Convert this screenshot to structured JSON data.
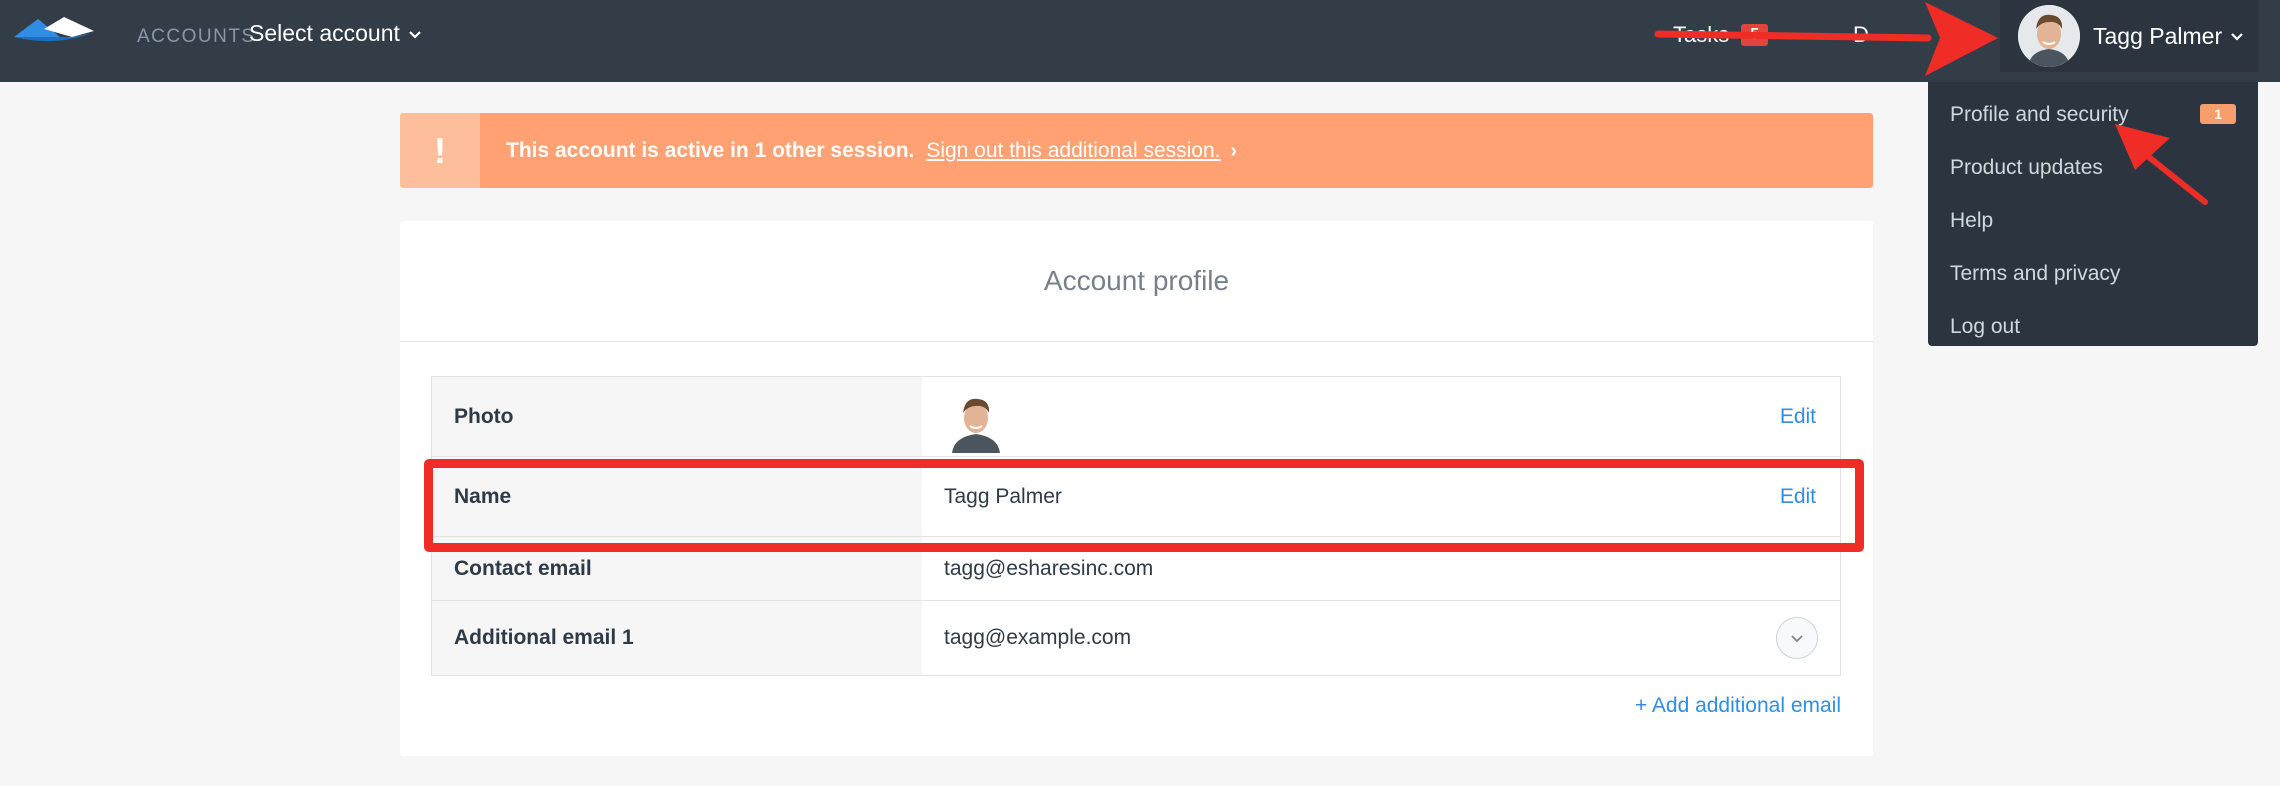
{
  "nav": {
    "accounts_label": "ACCOUNTS",
    "select_account": "Select account",
    "tasks_label": "Tasks",
    "tasks_count": "5",
    "extra_label": "D",
    "user_name": "Tagg Palmer"
  },
  "dropdown": {
    "items": [
      {
        "label": "Profile and security",
        "badge": "1"
      },
      {
        "label": "Product updates"
      },
      {
        "label": "Help"
      },
      {
        "label": "Terms and privacy"
      },
      {
        "label": "Log out"
      }
    ]
  },
  "alert": {
    "icon": "!",
    "message": "This account is active in 1 other session.",
    "link": "Sign out this additional session.",
    "link_arrow": "›"
  },
  "profile": {
    "title": "Account profile",
    "rows": [
      {
        "label": "Photo",
        "action": "Edit"
      },
      {
        "label": "Name",
        "value": "Tagg Palmer",
        "action": "Edit"
      },
      {
        "label": "Contact email",
        "value": "tagg@esharesinc.com"
      },
      {
        "label": "Additional email 1",
        "value": "tagg@example.com"
      }
    ],
    "add_email": "+ Add additional email"
  },
  "colors": {
    "nav_bg": "#333d48",
    "alert_bg": "#ffa173",
    "link_blue": "#2f8de4",
    "annotation_red": "#f02c26",
    "badge_orange": "#f79f6c"
  },
  "icons": [
    "logo-icon",
    "chevron-down-icon",
    "exclamation-icon",
    "avatar",
    "expand-circle-icon"
  ]
}
